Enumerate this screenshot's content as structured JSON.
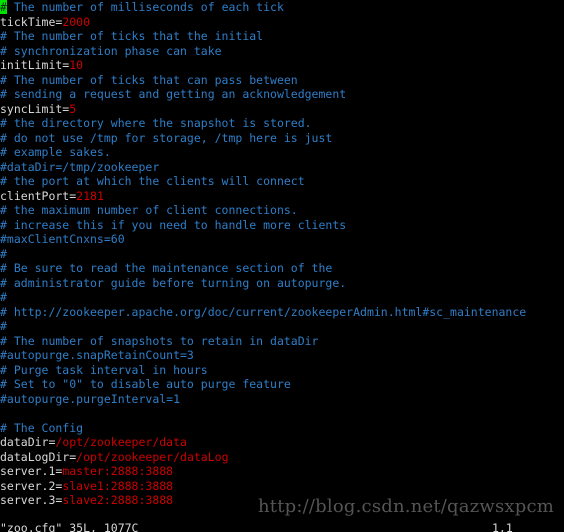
{
  "editor": {
    "app": "vim",
    "filename": "zoo.cfg",
    "background_color": "#000000",
    "cursor_color": "#00e500",
    "comment_color": "#2f7ec8",
    "value_color": "#cc0000",
    "key_color": "#d8d8d8",
    "cursor_char": "#",
    "lines": [
      {
        "segments": [
          {
            "text": "#",
            "style": "cursor"
          },
          {
            "text": " The number of milliseconds of each tick",
            "style": "comment"
          }
        ]
      },
      {
        "segments": [
          {
            "text": "tickTime=",
            "style": "key"
          },
          {
            "text": "2000",
            "style": "val"
          }
        ]
      },
      {
        "segments": [
          {
            "text": "# The number of ticks that the initial",
            "style": "comment"
          }
        ]
      },
      {
        "segments": [
          {
            "text": "# synchronization phase can take",
            "style": "comment"
          }
        ]
      },
      {
        "segments": [
          {
            "text": "initLimit=",
            "style": "key"
          },
          {
            "text": "10",
            "style": "val"
          }
        ]
      },
      {
        "segments": [
          {
            "text": "# The number of ticks that can pass between",
            "style": "comment"
          }
        ]
      },
      {
        "segments": [
          {
            "text": "# sending a request and getting an acknowledgement",
            "style": "comment"
          }
        ]
      },
      {
        "segments": [
          {
            "text": "syncLimit=",
            "style": "key"
          },
          {
            "text": "5",
            "style": "val"
          }
        ]
      },
      {
        "segments": [
          {
            "text": "# the directory where the snapshot is stored.",
            "style": "comment"
          }
        ]
      },
      {
        "segments": [
          {
            "text": "# do not use /tmp for storage, /tmp here is just",
            "style": "comment"
          }
        ]
      },
      {
        "segments": [
          {
            "text": "# example sakes.",
            "style": "comment"
          }
        ]
      },
      {
        "segments": [
          {
            "text": "#dataDir=/tmp/zookeeper",
            "style": "comment"
          }
        ]
      },
      {
        "segments": [
          {
            "text": "# the port at which the clients will connect",
            "style": "comment"
          }
        ]
      },
      {
        "segments": [
          {
            "text": "clientPort=",
            "style": "key"
          },
          {
            "text": "2181",
            "style": "val"
          }
        ]
      },
      {
        "segments": [
          {
            "text": "# the maximum number of client connections.",
            "style": "comment"
          }
        ]
      },
      {
        "segments": [
          {
            "text": "# increase this if you need to handle more clients",
            "style": "comment"
          }
        ]
      },
      {
        "segments": [
          {
            "text": "#maxClientCnxns=60",
            "style": "comment"
          }
        ]
      },
      {
        "segments": [
          {
            "text": "#",
            "style": "comment"
          }
        ]
      },
      {
        "segments": [
          {
            "text": "# Be sure to read the maintenance section of the",
            "style": "comment"
          }
        ]
      },
      {
        "segments": [
          {
            "text": "# administrator guide before turning on autopurge.",
            "style": "comment"
          }
        ]
      },
      {
        "segments": [
          {
            "text": "#",
            "style": "comment"
          }
        ]
      },
      {
        "segments": [
          {
            "text": "# http://zookeeper.apache.org/doc/current/zookeeperAdmin.html#sc_maintenance",
            "style": "comment"
          }
        ]
      },
      {
        "segments": [
          {
            "text": "#",
            "style": "comment"
          }
        ]
      },
      {
        "segments": [
          {
            "text": "# The number of snapshots to retain in dataDir",
            "style": "comment"
          }
        ]
      },
      {
        "segments": [
          {
            "text": "#autopurge.snapRetainCount=3",
            "style": "comment"
          }
        ]
      },
      {
        "segments": [
          {
            "text": "# Purge task interval in hours",
            "style": "comment"
          }
        ]
      },
      {
        "segments": [
          {
            "text": "# Set to \"0\" to disable auto purge feature",
            "style": "comment"
          }
        ]
      },
      {
        "segments": [
          {
            "text": "#autopurge.purgeInterval=1",
            "style": "comment"
          }
        ]
      },
      {
        "segments": [
          {
            "text": "",
            "style": "plain"
          }
        ]
      },
      {
        "segments": [
          {
            "text": "# The Config",
            "style": "comment"
          }
        ]
      },
      {
        "segments": [
          {
            "text": "dataDir=",
            "style": "key"
          },
          {
            "text": "/opt/zookeeper/data",
            "style": "val"
          }
        ]
      },
      {
        "segments": [
          {
            "text": "dataLogDir=",
            "style": "key"
          },
          {
            "text": "/opt/zookeeper/dataLog",
            "style": "val"
          }
        ]
      },
      {
        "segments": [
          {
            "text": "server.1=",
            "style": "key"
          },
          {
            "text": "master:2888:3888",
            "style": "val"
          }
        ]
      },
      {
        "segments": [
          {
            "text": "server.2=",
            "style": "key"
          },
          {
            "text": "slave1:2888:3888",
            "style": "val"
          }
        ]
      },
      {
        "segments": [
          {
            "text": "server.3=",
            "style": "key"
          },
          {
            "text": "slave2:2888:3888",
            "style": "val"
          }
        ]
      }
    ]
  },
  "statusbar": {
    "file_info": "\"zoo.cfg\" 35L, 1077C",
    "cursor_position": "1,1"
  },
  "watermark": {
    "text": "http://blog.csdn.net/qazwsxpcm"
  }
}
